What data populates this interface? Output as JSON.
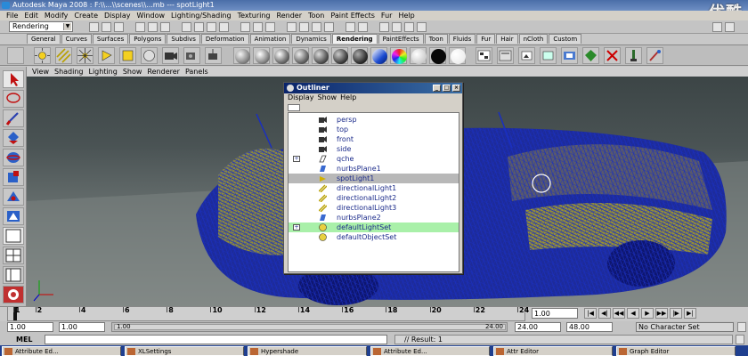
{
  "window": {
    "title": "Autodesk Maya 2008 : F:\\\\...\\\\scenes\\\\...mb --- spotLight1"
  },
  "watermark": "优酷",
  "menubar": [
    "File",
    "Edit",
    "Modify",
    "Create",
    "Display",
    "Window",
    "Lighting/Shading",
    "Texturing",
    "Render",
    "Toon",
    "Paint Effects",
    "Fur",
    "Help"
  ],
  "status": {
    "mode": "Rendering"
  },
  "shelf_tabs": [
    {
      "label": "General",
      "active": false
    },
    {
      "label": "Curves",
      "active": false
    },
    {
      "label": "Surfaces",
      "active": false
    },
    {
      "label": "Polygons",
      "active": false
    },
    {
      "label": "Subdivs",
      "active": false
    },
    {
      "label": "Deformation",
      "active": false
    },
    {
      "label": "Animation",
      "active": false
    },
    {
      "label": "Dynamics",
      "active": false
    },
    {
      "label": "Rendering",
      "active": true
    },
    {
      "label": "PaintEffects",
      "active": false
    },
    {
      "label": "Toon",
      "active": false
    },
    {
      "label": "Fluids",
      "active": false
    },
    {
      "label": "Fur",
      "active": false
    },
    {
      "label": "Hair",
      "active": false
    },
    {
      "label": "nCloth",
      "active": false
    },
    {
      "label": "Custom",
      "active": false
    }
  ],
  "panel_menu": [
    "View",
    "Shading",
    "Lighting",
    "Show",
    "Renderer",
    "Panels"
  ],
  "outliner": {
    "title": "Outliner",
    "menu": [
      "Display",
      "Show",
      "Help"
    ],
    "items": [
      {
        "name": "persp",
        "icon": "camera-icon",
        "state": "normal",
        "expandable": false
      },
      {
        "name": "top",
        "icon": "camera-icon",
        "state": "normal",
        "expandable": false
      },
      {
        "name": "front",
        "icon": "camera-icon",
        "state": "normal",
        "expandable": false
      },
      {
        "name": "side",
        "icon": "camera-icon",
        "state": "normal",
        "expandable": false
      },
      {
        "name": "qche",
        "icon": "transform-icon",
        "state": "normal",
        "expandable": true
      },
      {
        "name": "nurbsPlane1",
        "icon": "nurbs-plane-icon",
        "state": "normal",
        "expandable": false
      },
      {
        "name": "spotLight1",
        "icon": "spot-light-icon",
        "state": "selected",
        "expandable": false
      },
      {
        "name": "directionalLight1",
        "icon": "directional-light-icon",
        "state": "normal",
        "expandable": false
      },
      {
        "name": "directionalLight2",
        "icon": "directional-light-icon",
        "state": "normal",
        "expandable": false
      },
      {
        "name": "directionalLight3",
        "icon": "directional-light-icon",
        "state": "normal",
        "expandable": false
      },
      {
        "name": "nurbsPlane2",
        "icon": "nurbs-plane-icon",
        "state": "normal",
        "expandable": false
      },
      {
        "name": "defaultLightSet",
        "icon": "set-icon",
        "state": "highlighted",
        "expandable": true
      },
      {
        "name": "defaultObjectSet",
        "icon": "set-icon",
        "state": "normal",
        "expandable": false
      }
    ]
  },
  "timeline": {
    "ticks": [
      "1",
      "2",
      "4",
      "6",
      "8",
      "10",
      "12",
      "14",
      "16",
      "18",
      "20",
      "22",
      "24"
    ],
    "current_frame": "1.00"
  },
  "range": {
    "start": "1.00",
    "inner_start": "1.00",
    "inner_end": "24.00",
    "slider_label": "24.00",
    "end": "24.00",
    "end2": "48.00",
    "character_set": "No Character Set"
  },
  "command": {
    "label": "MEL",
    "result": "// Result: 1"
  },
  "taskbar": [
    "Attribute Ed...",
    "XLSettings",
    "Hypershade",
    "Attribute Ed...",
    "Attr Editor",
    "Graph Editor"
  ]
}
